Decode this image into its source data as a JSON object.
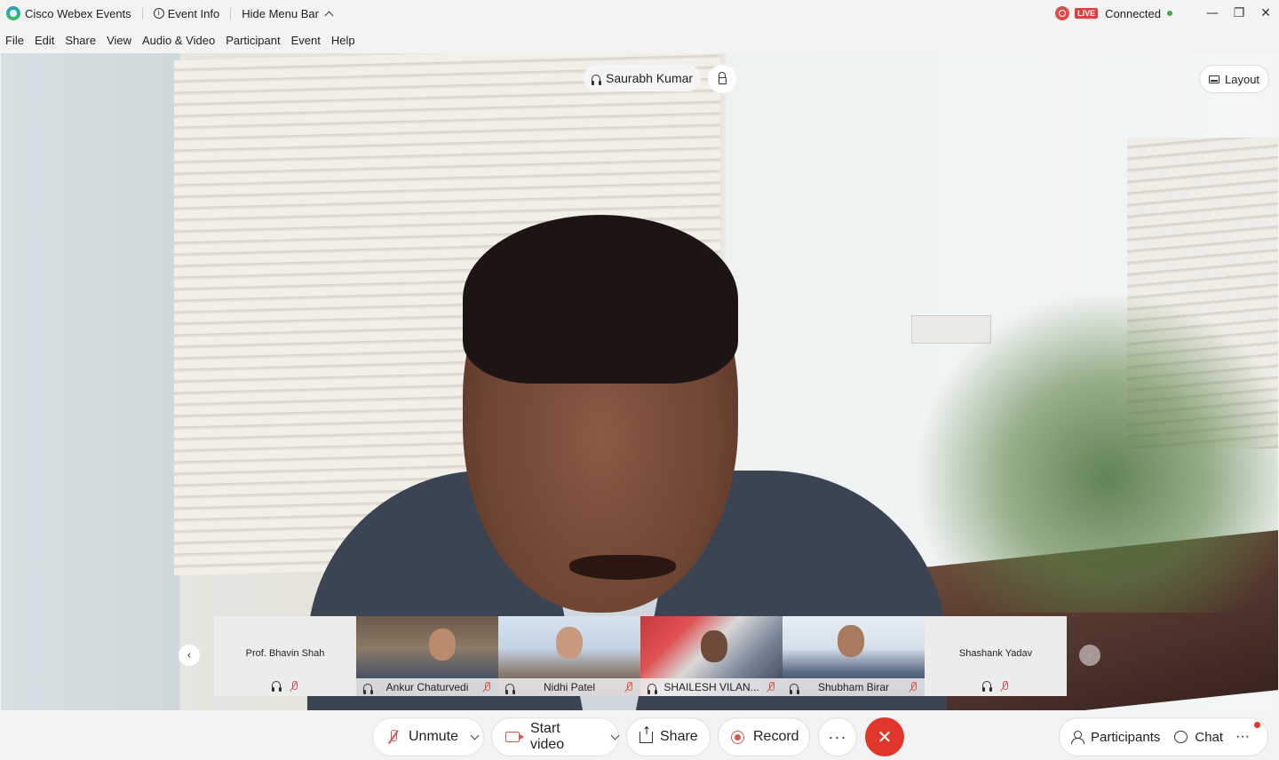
{
  "window": {
    "app_title": "Cisco Webex Events",
    "event_info": "Event Info",
    "hide_menu_bar": "Hide Menu Bar",
    "live_badge": "LIVE",
    "connection_status": "Connected",
    "minimize": "—",
    "restore": "❐",
    "close": "✕"
  },
  "menu": [
    "File",
    "Edit",
    "Share",
    "View",
    "Audio & Video",
    "Participant",
    "Event",
    "Help"
  ],
  "stage": {
    "active_speaker": "Saurabh Kumar",
    "layout_label": "Layout"
  },
  "filmstrip": {
    "tiles": [
      {
        "name": "Prof. Bhavin Shah",
        "video": false
      },
      {
        "name": "Ankur Chaturvedi",
        "video": true
      },
      {
        "name": "Nidhi Patel",
        "video": true
      },
      {
        "name": "SHAILESH VILAN...",
        "video": true
      },
      {
        "name": "Shubham Birar",
        "video": true
      },
      {
        "name": "Shashank Yadav",
        "video": false
      }
    ],
    "prev_arrow": "‹",
    "next_arrow": "›"
  },
  "controls": {
    "unmute": "Unmute",
    "start_video": "Start video",
    "share": "Share",
    "record": "Record",
    "more": "···",
    "end": "✕",
    "participants": "Participants",
    "chat": "Chat",
    "panel_more": "···"
  },
  "colors": {
    "end_button": "#e0362c",
    "muted_icon": "#d9534f",
    "connected_dot": "#3dab4a"
  }
}
